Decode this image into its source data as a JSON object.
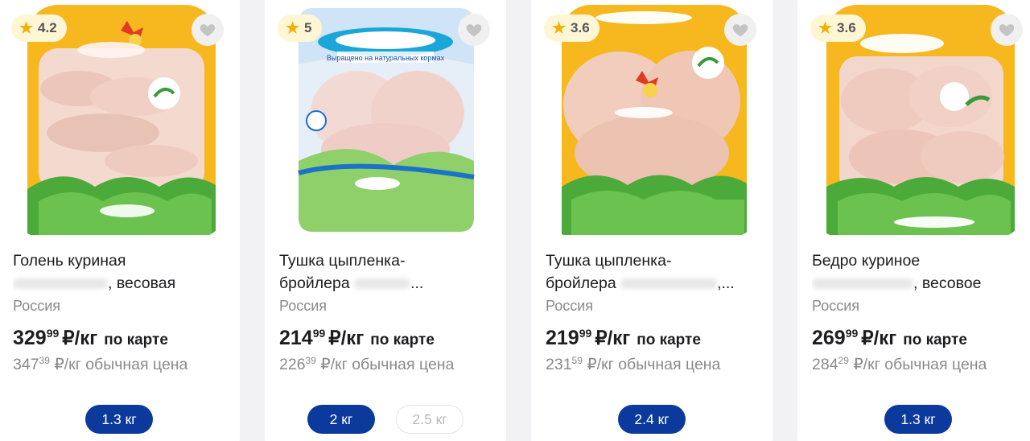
{
  "products": [
    {
      "rating": "4.2",
      "title_line1": "Голень куриная",
      "title_line2": ", весовая",
      "country": "Россия",
      "card_price_int": "329",
      "card_price_dec": "99",
      "card_price_unit": "₽/кг",
      "card_price_note": "по карте",
      "regular_price_int": "347",
      "regular_price_dec": "39",
      "regular_price_text": "₽/кг обычная цена",
      "weights": [
        "1.3 кг"
      ]
    },
    {
      "rating": "5",
      "title_line1": "Тушка цыпленка-",
      "title_line2": "бройлера",
      "title_line2_tail": "...",
      "country": "Россия",
      "card_price_int": "214",
      "card_price_dec": "99",
      "card_price_unit": "₽/кг",
      "card_price_note": "по карте",
      "regular_price_int": "226",
      "regular_price_dec": "39",
      "regular_price_text": "₽/кг обычная цена",
      "weights": [
        "2 кг",
        "2.5 кг"
      ],
      "package_text": "Выращено на натуральных кормах"
    },
    {
      "rating": "3.6",
      "title_line1": "Тушка цыпленка-",
      "title_line2": "бройлера",
      "title_line2_tail": ",...",
      "country": "Россия",
      "card_price_int": "219",
      "card_price_dec": "99",
      "card_price_unit": "₽/кг",
      "card_price_note": "по карте",
      "regular_price_int": "231",
      "regular_price_dec": "59",
      "regular_price_text": "₽/кг обычная цена",
      "weights": [
        "2.4 кг"
      ]
    },
    {
      "rating": "3.6",
      "title_line1": "Бедро куриное",
      "title_line2": ", весовое",
      "country": "Россия",
      "card_price_int": "269",
      "card_price_dec": "99",
      "card_price_unit": "₽/кг",
      "card_price_note": "по карте",
      "regular_price_int": "284",
      "regular_price_dec": "29",
      "regular_price_text": "₽/кг обычная цена",
      "weights": [
        "1.3 кг"
      ]
    }
  ],
  "colors": {
    "primary_pill": "#0b3a9c",
    "rating_bg": "#fff6d6",
    "star": "#f4b000",
    "tray_yellow": "#f6b81e",
    "greens": "#4caa3a"
  },
  "icons": {
    "rating": "star-icon",
    "favorite": "heart-icon"
  }
}
